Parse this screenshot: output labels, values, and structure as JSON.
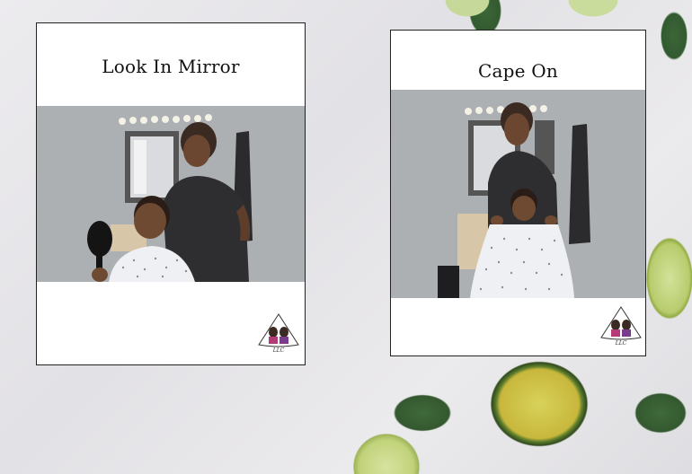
{
  "cards": [
    {
      "title": "Look In Mirror",
      "photo": "barber-mirror-scene",
      "logo_caption": "LLC"
    },
    {
      "title": "Cape On",
      "photo": "barber-cape-scene",
      "logo_caption": "LLC"
    }
  ],
  "colors": {
    "card_bg": "#ffffff",
    "wall": "#adb0b3",
    "shirt": "#2e2e30",
    "cape": "#eef0f3"
  }
}
